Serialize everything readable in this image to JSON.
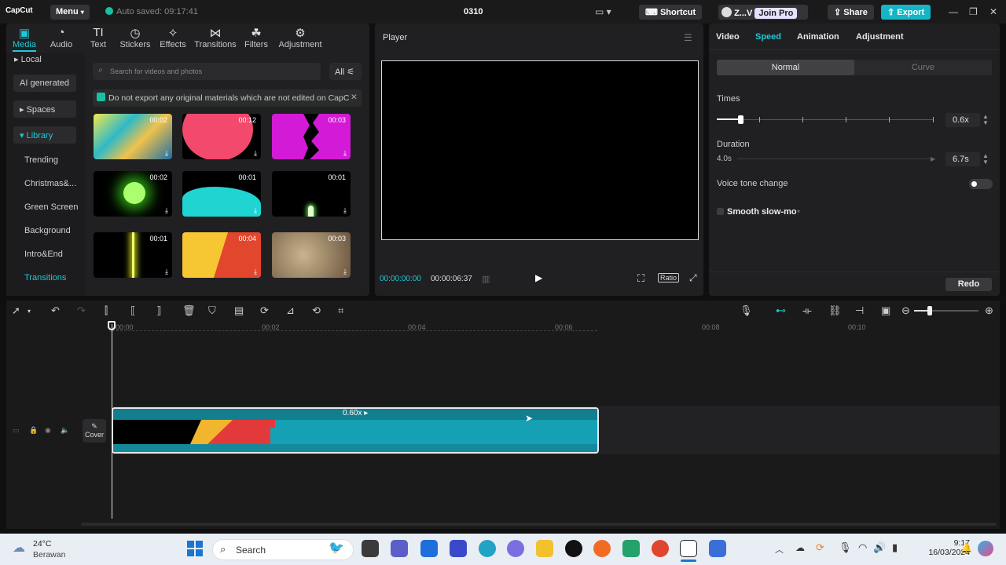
{
  "topbar": {
    "app_name": "CapCut",
    "menu_label": "Menu",
    "autosave": "Auto saved: 09:17:41",
    "project_title": "0310",
    "shortcut_label": "Shortcut",
    "user_label": "Z...V",
    "join_pro": "Join Pro",
    "share_label": "Share",
    "export_label": "Export"
  },
  "tools": [
    {
      "label": "Media",
      "icon": "media-icon"
    },
    {
      "label": "Audio",
      "icon": "audio-icon"
    },
    {
      "label": "Text",
      "icon": "text-icon"
    },
    {
      "label": "Stickers",
      "icon": "stickers-icon"
    },
    {
      "label": "Effects",
      "icon": "effects-icon"
    },
    {
      "label": "Transitions",
      "icon": "transitions-icon"
    },
    {
      "label": "Filters",
      "icon": "filters-icon"
    },
    {
      "label": "Adjustment",
      "icon": "adjustment-icon"
    }
  ],
  "left_nav": {
    "local": "Local",
    "ai_generated": "AI generated",
    "spaces": "Spaces",
    "library": "Library",
    "sub_items": [
      "Trending",
      "Christmas&...",
      "Green Screen",
      "Background",
      "Intro&End",
      "Transitions"
    ]
  },
  "media": {
    "search_placeholder": "Search for videos and photos",
    "all_label": "All",
    "notice": "Do not export any original materials which are not edited on CapC",
    "thumbs": [
      {
        "duration": "00:02"
      },
      {
        "duration": "00:12"
      },
      {
        "duration": "00:03"
      },
      {
        "duration": "00:02"
      },
      {
        "duration": "00:01"
      },
      {
        "duration": "00:01"
      },
      {
        "duration": "00:01"
      },
      {
        "duration": "00:04"
      },
      {
        "duration": "00:03"
      }
    ]
  },
  "player": {
    "title": "Player",
    "current_time": "00:00:00:00",
    "total_time": "00:00:06:37",
    "ratio_label": "Ratio"
  },
  "right_panel": {
    "tabs": [
      "Video",
      "Speed",
      "Animation",
      "Adjustment"
    ],
    "active_tab": "Speed",
    "normal_label": "Normal",
    "curve_label": "Curve",
    "times_label": "Times",
    "times_value": "0.6x",
    "times_fraction": 0.11,
    "duration_label": "Duration",
    "duration_original": "4.0s",
    "duration_value": "6.7s",
    "voice_tone_label": "Voice tone change",
    "smooth_label": "Smooth slow-mo",
    "redo_label": "Redo"
  },
  "timeline": {
    "ruler": [
      "00:00",
      "00:02",
      "00:04",
      "00:06",
      "00:08",
      "00:10"
    ],
    "clip_speed": "0.60x",
    "cover_label": "Cover"
  },
  "taskbar": {
    "temperature": "24°C",
    "weather": "Berawan",
    "search_label": "Search",
    "time": "9:17",
    "date": "16/03/2024"
  },
  "colors": {
    "accent": "#1fc9d6",
    "export": "#13b5c6",
    "clip": "#16a0b5"
  }
}
